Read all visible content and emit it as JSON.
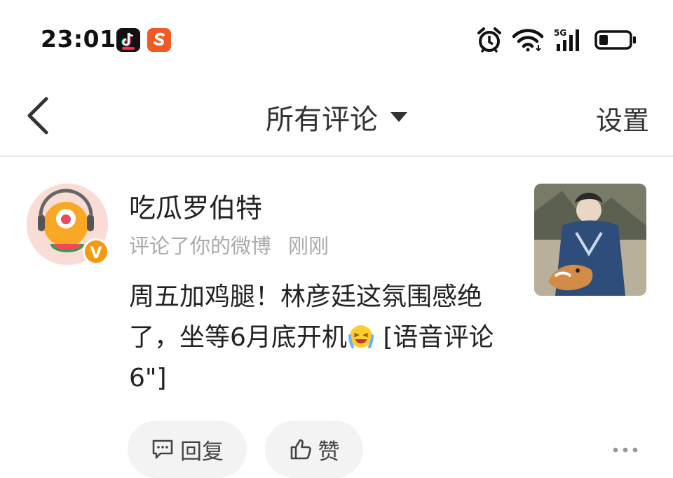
{
  "status_bar": {
    "time": "23:01",
    "network": "5G",
    "icons": [
      "tiktok-lite-icon",
      "sogou-icon",
      "alarm-icon",
      "wifi-icon",
      "signal-icon",
      "battery-icon"
    ],
    "battery_level": 0.3
  },
  "nav": {
    "back_icon": "chevron-left-icon",
    "title": "所有评论",
    "dropdown_icon": "caret-down-icon",
    "settings_label": "设置"
  },
  "comment": {
    "username": "吃瓜罗伯特",
    "action": "评论了你的微博",
    "timestamp": "刚刚",
    "verified_badge": "V",
    "text_before_emoji": "周五加鸡腿！林彦廷这氛围感绝了，坐等6月底开机",
    "emoji": "laugh-cry-emoji",
    "text_after_emoji": " [语音评论6\"]",
    "reply_label": "回复",
    "like_label": "赞",
    "more_icon": "more-dots-icon"
  },
  "colors": {
    "badge": "#f59a0e",
    "sogou": "#f05a22",
    "meta_text": "#aaaaaa",
    "pill_bg": "#f3f3f3"
  }
}
